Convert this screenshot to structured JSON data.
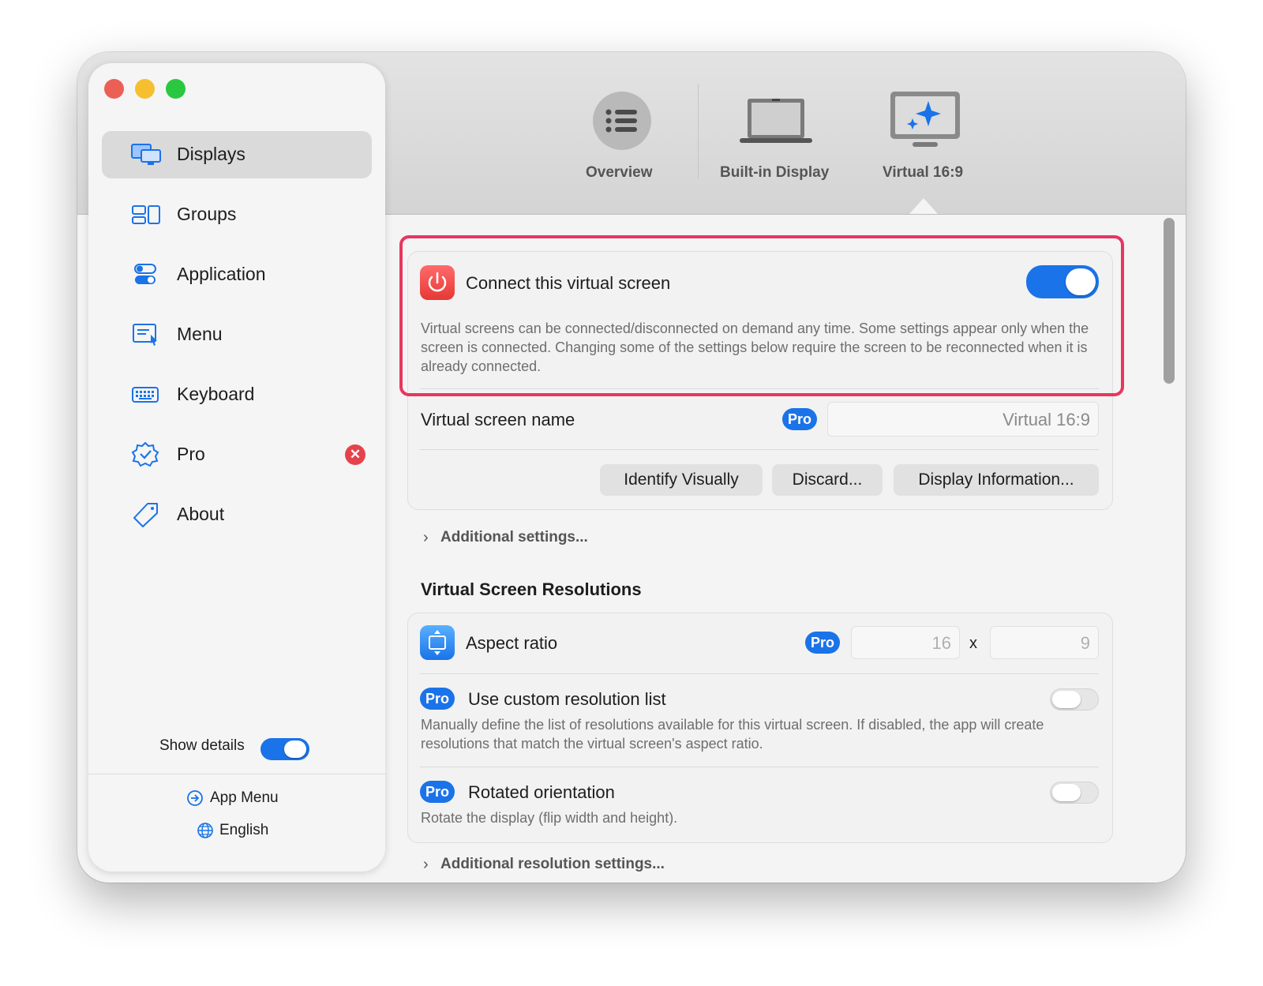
{
  "window": {
    "traffic_lights": {
      "close": "#ec5f57",
      "minimize": "#f5bf2f",
      "zoom": "#2ac840"
    }
  },
  "sidebar": {
    "items": [
      {
        "label": "Displays",
        "icon": "displays-icon",
        "active": true
      },
      {
        "label": "Groups",
        "icon": "groups-icon"
      },
      {
        "label": "Application",
        "icon": "application-icon"
      },
      {
        "label": "Menu",
        "icon": "menu-icon"
      },
      {
        "label": "Keyboard",
        "icon": "keyboard-icon"
      },
      {
        "label": "Pro",
        "icon": "pro-seal-icon",
        "badge": "✕"
      },
      {
        "label": "About",
        "icon": "tag-icon"
      }
    ],
    "show_details_label": "Show details",
    "show_details_on": true,
    "footer": {
      "app_menu": "App Menu",
      "language": "English"
    }
  },
  "toolbar": {
    "tabs": [
      {
        "label": "Overview",
        "icon": "list-icon"
      },
      {
        "label": "Built-in Display",
        "icon": "laptop-icon"
      },
      {
        "label": "Virtual 16:9",
        "icon": "virtual-display-icon",
        "selected": true
      }
    ]
  },
  "connect": {
    "label": "Connect this virtual screen",
    "enabled": true,
    "description": "Virtual screens can be connected/disconnected on demand any time. Some settings appear only when the screen is connected. Changing some of the settings below require the screen to be reconnected when it is already connected."
  },
  "name_row": {
    "label": "Virtual screen name",
    "pro": "Pro",
    "value": "Virtual 16:9"
  },
  "buttons": {
    "identify": "Identify Visually",
    "discard": "Discard...",
    "info": "Display Information..."
  },
  "additional_settings": "Additional settings...",
  "resolutions": {
    "title": "Virtual Screen Resolutions",
    "aspect": {
      "label": "Aspect ratio",
      "pro": "Pro",
      "width": "16",
      "times": "x",
      "height": "9"
    },
    "custom_list": {
      "pro": "Pro",
      "label": "Use custom resolution list",
      "enabled": false,
      "description": "Manually define the list of resolutions available for this virtual screen. If disabled, the app will create resolutions that match the virtual screen's aspect ratio."
    },
    "rotated": {
      "pro": "Pro",
      "label": "Rotated orientation",
      "enabled": false,
      "description": "Rotate the display (flip width and height)."
    },
    "more": "Additional resolution settings..."
  },
  "colors": {
    "accent": "#1a73e8",
    "highlight": "#e8365f",
    "danger": "#e5434b"
  }
}
